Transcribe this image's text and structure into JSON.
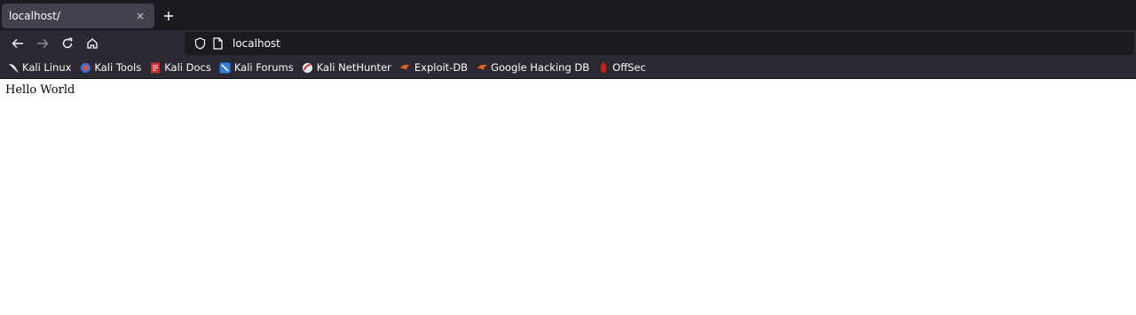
{
  "tab": {
    "title": "localhost/",
    "close_glyph": "×"
  },
  "new_tab_icon": "plus-icon",
  "nav": {
    "back_icon": "back-arrow-icon",
    "forward_icon": "forward-arrow-icon",
    "reload_icon": "reload-icon",
    "home_icon": "home-icon"
  },
  "url_bar": {
    "value": "localhost",
    "shield_icon": "shield-icon",
    "page_icon": "page-icon"
  },
  "bookmarks": [
    {
      "label": "Kali Linux",
      "icon": "kali-dragon-icon"
    },
    {
      "label": "Kali Tools",
      "icon": "kali-tools-icon"
    },
    {
      "label": "Kali Docs",
      "icon": "kali-docs-icon"
    },
    {
      "label": "Kali Forums",
      "icon": "kali-forums-icon"
    },
    {
      "label": "Kali NetHunter",
      "icon": "nethunter-icon"
    },
    {
      "label": "Exploit-DB",
      "icon": "exploit-db-icon"
    },
    {
      "label": "Google Hacking DB",
      "icon": "ghdb-icon"
    },
    {
      "label": "OffSec",
      "icon": "offsec-icon"
    }
  ],
  "page": {
    "text": "Hello World"
  },
  "colors": {
    "tabstrip_bg": "#1c1b22",
    "toolbar_bg": "#2b2a33",
    "urlbar_bg": "#1c1b22",
    "text": "#fbfbfe"
  }
}
